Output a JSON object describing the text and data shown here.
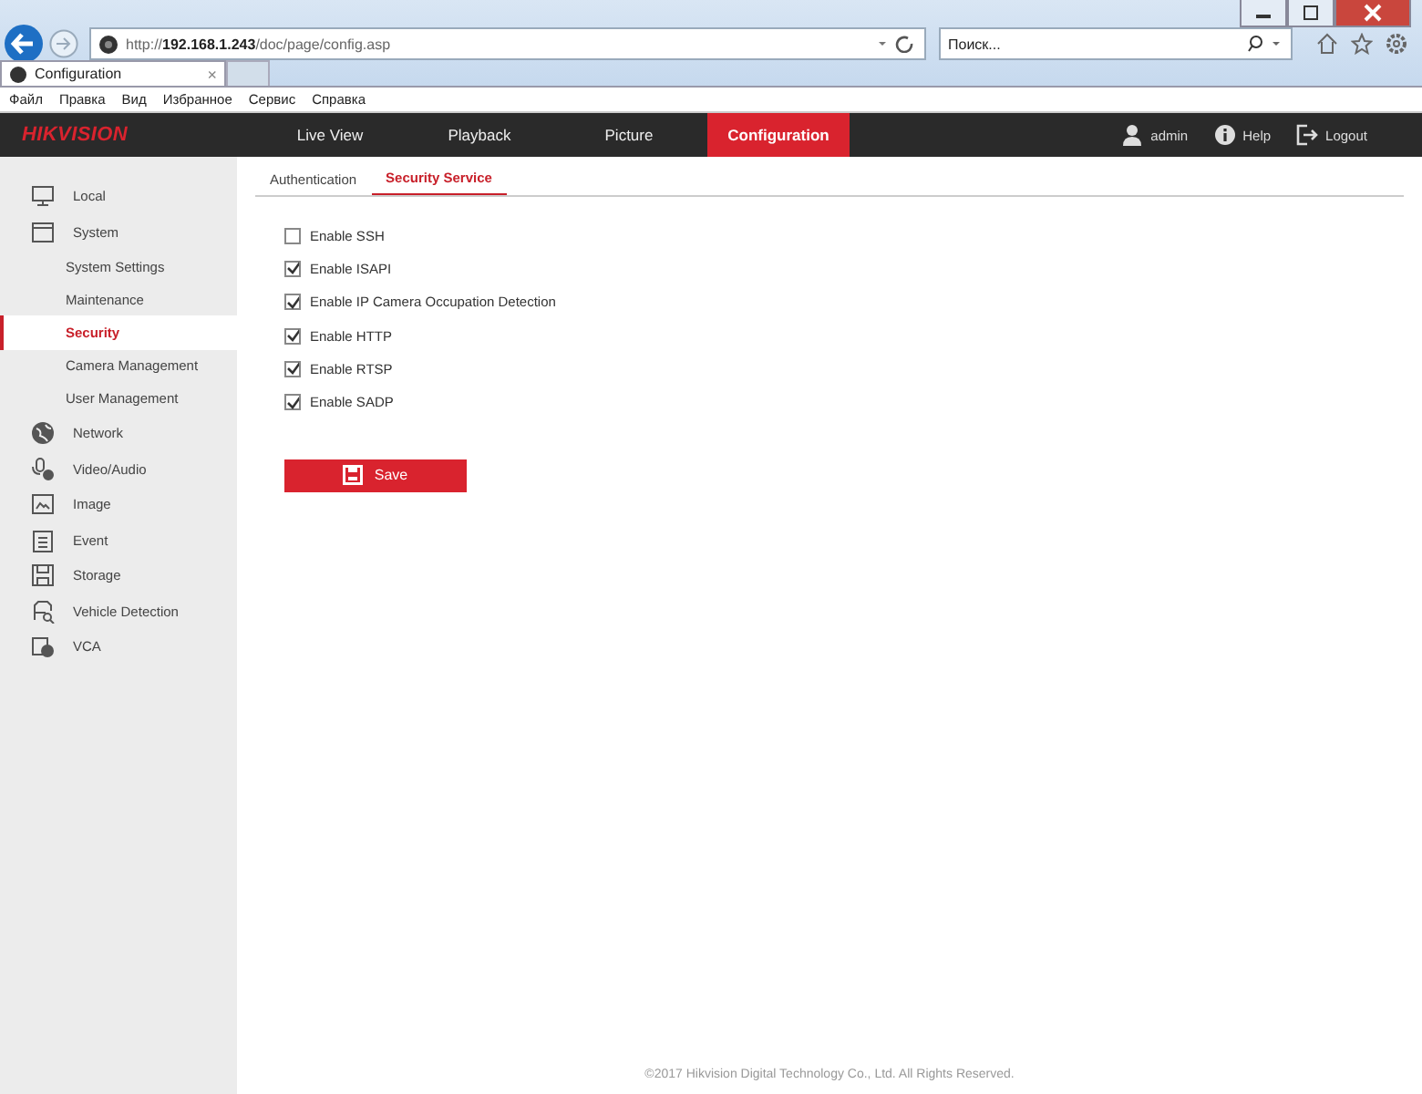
{
  "browser": {
    "address": "http://**192.168.1.243**/doc/page/config.asp",
    "search_placeholder": "Поиск...",
    "tab": {
      "title": "Configuration",
      "close": "×"
    },
    "menu": [
      "Файл",
      "Правка",
      "Вид",
      "Избранное",
      "Сервис",
      "Справка"
    ]
  },
  "app": {
    "logo": "HIKVISION",
    "nav": [
      {
        "label": "Live View",
        "selected": false
      },
      {
        "label": "Playback",
        "selected": false
      },
      {
        "label": "Picture",
        "selected": false
      },
      {
        "label": "Configuration",
        "selected": true
      }
    ],
    "user": "admin",
    "help": "Help",
    "logout": "Logout"
  },
  "sidebar": [
    {
      "label": "Local",
      "selected": false
    },
    {
      "label": "System",
      "selected": false,
      "children": [
        {
          "label": "System Settings",
          "selected": false
        },
        {
          "label": "Maintenance",
          "selected": false
        },
        {
          "label": "Security",
          "selected": true
        },
        {
          "label": "Camera Management",
          "selected": false
        },
        {
          "label": "User Management",
          "selected": false
        }
      ]
    },
    {
      "label": "Network",
      "selected": false
    },
    {
      "label": "Video/Audio",
      "selected": false
    },
    {
      "label": "Image",
      "selected": false
    },
    {
      "label": "Event",
      "selected": false
    },
    {
      "label": "Storage",
      "selected": false
    },
    {
      "label": "Vehicle Detection",
      "selected": false
    },
    {
      "label": "VCA",
      "selected": false
    }
  ],
  "tabs": [
    {
      "label": "Authentication",
      "selected": false
    },
    {
      "label": "Security Service",
      "selected": true
    }
  ],
  "options": [
    {
      "label": "Enable SSH",
      "checked": false
    },
    {
      "label": "Enable ISAPI",
      "checked": true
    },
    {
      "label": "Enable IP Camera Occupation Detection",
      "checked": true
    },
    {
      "label": "Enable HTTP",
      "checked": true
    },
    {
      "label": "Enable RTSP",
      "checked": true
    },
    {
      "label": "Enable SADP",
      "checked": true
    }
  ],
  "save": "Save",
  "footer": "©2017 Hikvision Digital Technology Co., Ltd. All Rights Reserved."
}
